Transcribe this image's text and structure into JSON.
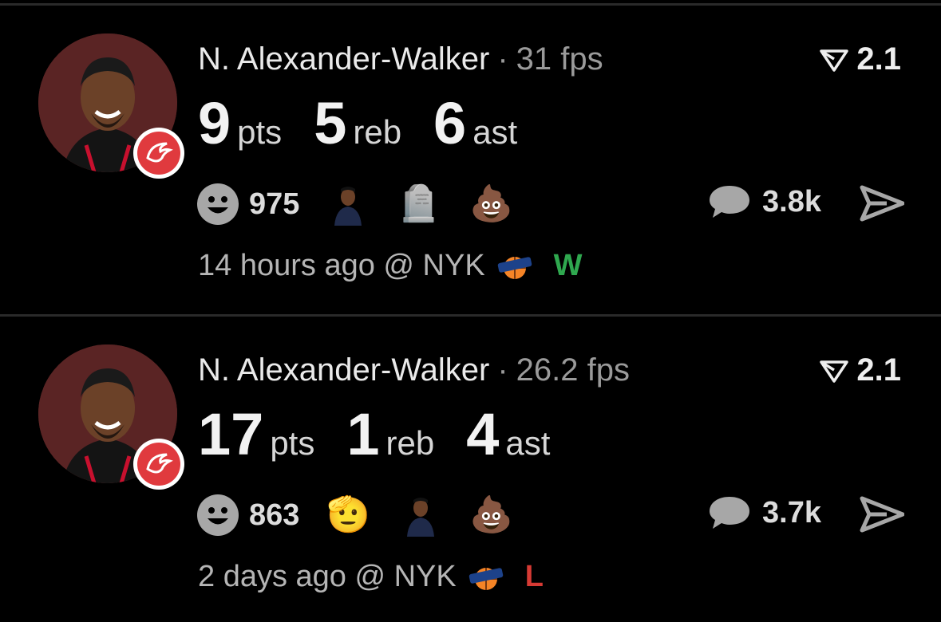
{
  "cards": [
    {
      "player_name": "N. Alexander-Walker",
      "separator": "·",
      "fps": "31 fps",
      "score_icon": "fantasy-v-icon",
      "score": "2.1",
      "stats": [
        {
          "value": "9",
          "unit": "pts"
        },
        {
          "value": "5",
          "unit": "reb"
        },
        {
          "value": "6",
          "unit": "ast"
        }
      ],
      "reaction_count": "975",
      "reaction_emojis": [
        "player-photo",
        "🪦",
        "💩"
      ],
      "comment_count": "3.8k",
      "time": "14 hours ago @ NYK",
      "result": "W",
      "result_color": "#2fa84f"
    },
    {
      "player_name": "N. Alexander-Walker",
      "separator": "·",
      "fps": "26.2 fps",
      "score_icon": "fantasy-v-icon",
      "score": "2.1",
      "stats": [
        {
          "value": "17",
          "unit": "pts"
        },
        {
          "value": "1",
          "unit": "reb"
        },
        {
          "value": "4",
          "unit": "ast"
        }
      ],
      "reaction_count": "863",
      "reaction_emojis": [
        "🫡",
        "player-photo",
        "💩"
      ],
      "comment_count": "3.7k",
      "time": "2 days ago @ NYK",
      "result": "L",
      "result_color": "#d63a34"
    }
  ],
  "colors": {
    "background": "#000000",
    "muted": "#9a9a9a",
    "hawks_red": "#e03a3e"
  }
}
